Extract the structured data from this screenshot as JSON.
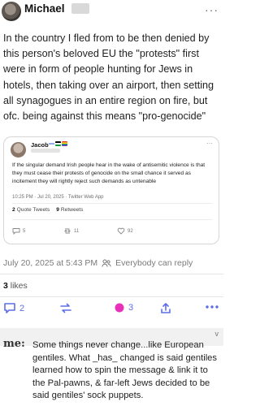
{
  "post": {
    "author": "Michael",
    "text": "In the country I fled from to be then denied by this person's beloved EU the \"protests\" first were in form of people hunting for Jews in hotels, then taking over an airport, then setting all synagogues in an entire region on fire, but ofc. being against this means \"pro-genocide\"",
    "quote": {
      "name": "Jacob",
      "text": "If the singular demand Irish people hear in the wake of antisemitic violence is that they must cease their protests of genocide on the small chance it served as incitement they will rightly reject such demands as untenable",
      "meta": "10:25 PM · Jul 20, 2025 · Twitter Web App",
      "quote_tweets_count": "2",
      "quote_tweets_label": "Quote Tweets",
      "retweets_count": "9",
      "retweets_label": "Retweets",
      "replies": "5",
      "reposts": "11",
      "likes": "92"
    },
    "timestamp": "July 20, 2025 at 5:43 PM",
    "visibility": "Everybody can reply",
    "likes_count": "3",
    "likes_label": "likes",
    "actions": {
      "replies": "2",
      "favourites": "3"
    }
  },
  "reply": {
    "avatar_text": "me:",
    "text": "Some things never change...like European gentiles. What _has_ changed is said gentiles learned how to spin the message & link it to the Pal-pawns, & far-left Jews decided to be said gentiles' sock puppets."
  },
  "colors": {
    "accent": "#5b6ee8",
    "text": "#1f1f1f",
    "muted": "#7b7b7b"
  },
  "icons": [
    "more-icon",
    "flag-icon",
    "reply-icon",
    "boost-icon",
    "star-icon",
    "share-icon",
    "people-icon"
  ]
}
